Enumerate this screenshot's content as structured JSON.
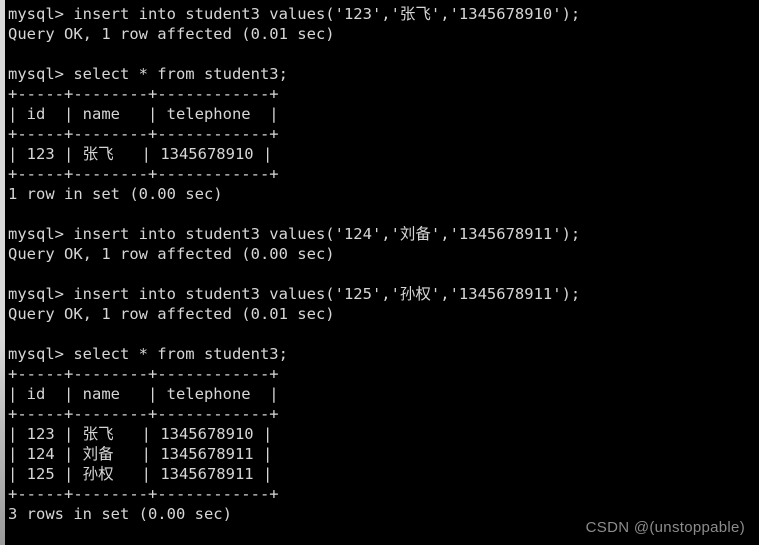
{
  "terminal": {
    "prompt": "mysql>",
    "foreground_color": "#d6d6d6",
    "background_color": "#000000",
    "lines": [
      "mysql> insert into student3 values('123','张飞','1345678910');",
      "Query OK, 1 row affected (0.01 sec)",
      "",
      "mysql> select * from student3;",
      "+-----+--------+------------+",
      "| id  | name   | telephone  |",
      "+-----+--------+------------+",
      "| 123 | 张飞   | 1345678910 |",
      "+-----+--------+------------+",
      "1 row in set (0.00 sec)",
      "",
      "mysql> insert into student3 values('124','刘备','1345678911');",
      "Query OK, 1 row affected (0.00 sec)",
      "",
      "mysql> insert into student3 values('125','孙权','1345678911');",
      "Query OK, 1 row affected (0.01 sec)",
      "",
      "mysql> select * from student3;",
      "+-----+--------+------------+",
      "| id  | name   | telephone  |",
      "+-----+--------+------------+",
      "| 123 | 张飞   | 1345678910 |",
      "| 124 | 刘备   | 1345678911 |",
      "| 125 | 孙权   | 1345678911 |",
      "+-----+--------+------------+",
      "3 rows in set (0.00 sec)"
    ],
    "commands": [
      "insert into student3 values('123','张飞','1345678910');",
      "select * from student3;",
      "insert into student3 values('124','刘备','1345678911');",
      "insert into student3 values('125','孙权','1345678911');",
      "select * from student3;"
    ],
    "status_messages": [
      "Query OK, 1 row affected (0.01 sec)",
      "1 row in set (0.00 sec)",
      "Query OK, 1 row affected (0.00 sec)",
      "Query OK, 1 row affected (0.01 sec)",
      "3 rows in set (0.00 sec)"
    ],
    "result_tables": [
      {
        "headers": [
          "id",
          "name",
          "telephone"
        ],
        "rows": [
          [
            "123",
            "张飞",
            "1345678910"
          ]
        ],
        "row_count_text": "1 row in set (0.00 sec)"
      },
      {
        "headers": [
          "id",
          "name",
          "telephone"
        ],
        "rows": [
          [
            "123",
            "张飞",
            "1345678910"
          ],
          [
            "124",
            "刘备",
            "1345678911"
          ],
          [
            "125",
            "孙权",
            "1345678911"
          ]
        ],
        "row_count_text": "3 rows in set (0.00 sec)"
      }
    ],
    "table_name": "student3"
  },
  "watermark": {
    "text": "CSDN @(unstoppable)",
    "color": "#8c8c8c"
  }
}
